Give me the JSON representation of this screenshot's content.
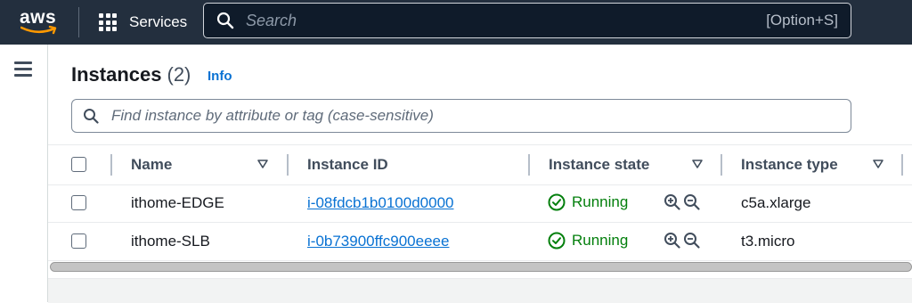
{
  "topnav": {
    "logo_text": "aws",
    "services_label": "Services",
    "search_placeholder": "Search",
    "search_shortcut": "[Option+S]"
  },
  "page": {
    "title": "Instances",
    "count": "(2)",
    "info_label": "Info",
    "filter_placeholder": "Find instance by attribute or tag (case-sensitive)"
  },
  "table": {
    "columns": [
      "Name",
      "Instance ID",
      "Instance state",
      "Instance type"
    ],
    "rows": [
      {
        "name": "ithome-EDGE",
        "instance_id": "i-08fdcb1b0100d0000",
        "state": "Running",
        "type": "c5a.xlarge"
      },
      {
        "name": "ithome-SLB",
        "instance_id": "i-0b73900ffc900eeee",
        "state": "Running",
        "type": "t3.micro"
      }
    ]
  },
  "colors": {
    "nav_bg": "#232f3e",
    "link": "#0972d3",
    "running": "#037f0c",
    "aws_orange": "#ff9900"
  },
  "icons": [
    "grid-icon",
    "search-icon",
    "hamburger-icon",
    "sort-icon",
    "check-circle-icon",
    "zoom-in-icon",
    "zoom-out-icon"
  ]
}
